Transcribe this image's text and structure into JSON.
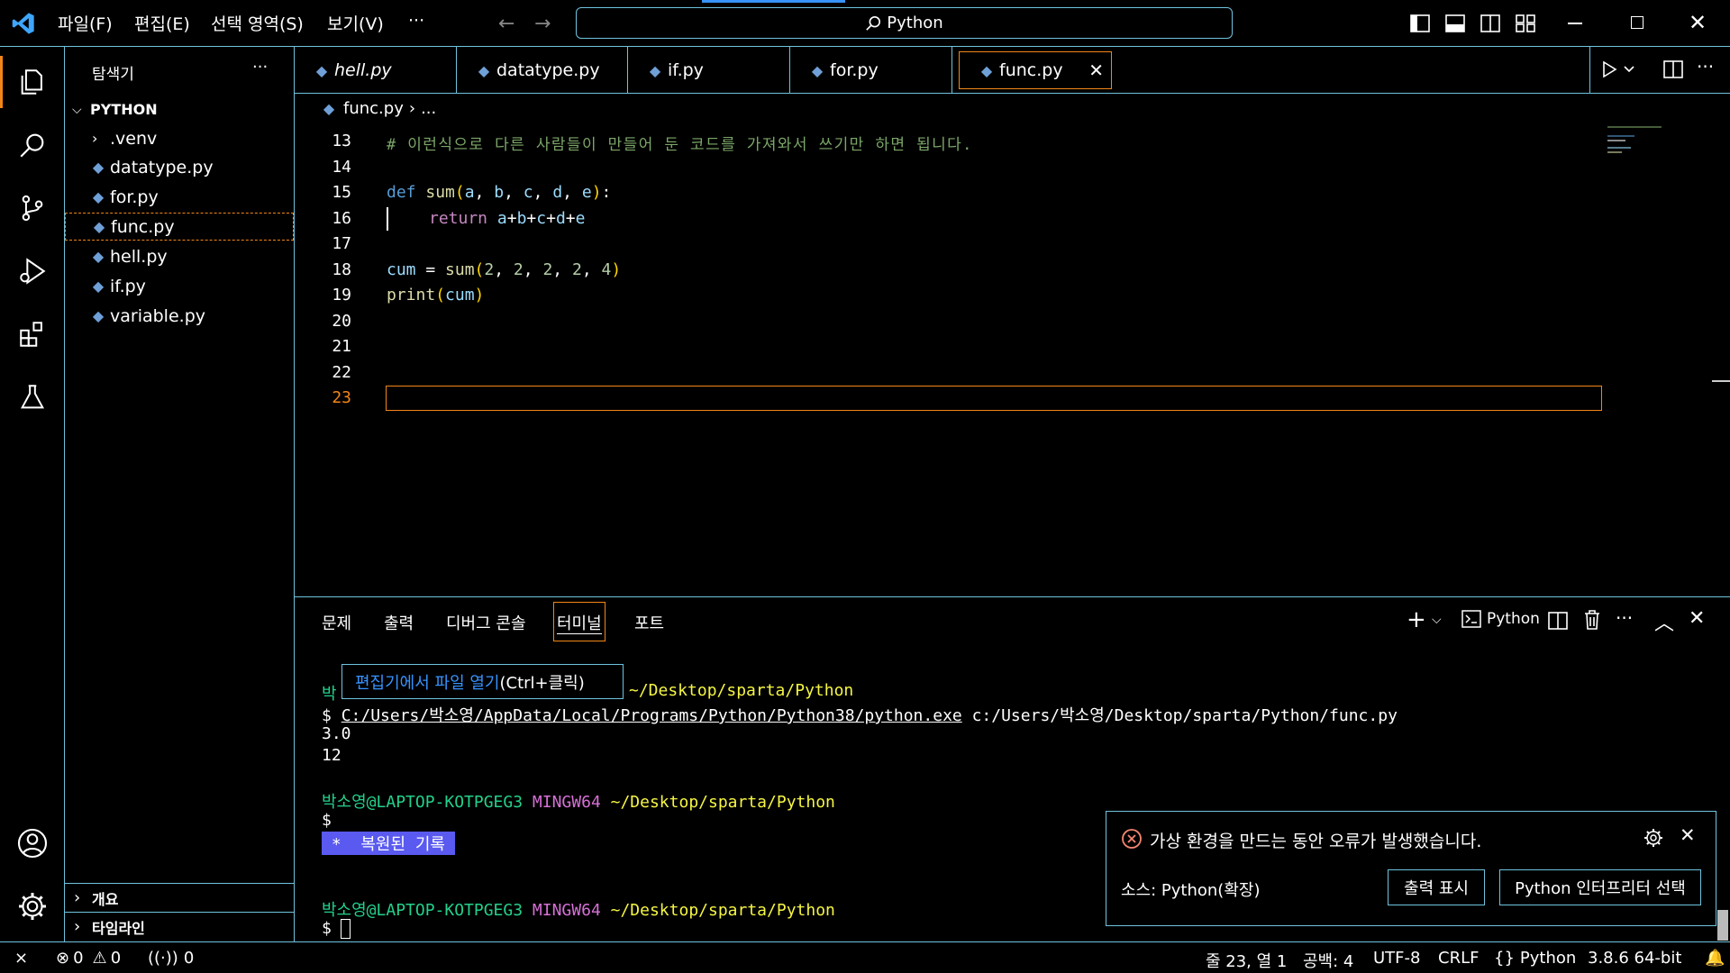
{
  "titlebar": {
    "menus": [
      "파일(F)",
      "편집(E)",
      "선택 영역(S)",
      "보기(V)",
      "···"
    ],
    "search_text": "Python"
  },
  "sidebar": {
    "title": "탐색기",
    "more": "···",
    "root": "PYTHON",
    "items": [
      ".venv",
      "datatype.py",
      "for.py",
      "func.py",
      "hell.py",
      "if.py",
      "variable.py"
    ],
    "outline": "개요",
    "timeline": "타임라인"
  },
  "tabs": [
    {
      "label": "hell.py"
    },
    {
      "label": "datatype.py"
    },
    {
      "label": "if.py"
    },
    {
      "label": "for.py"
    },
    {
      "label": "func.py",
      "active": true
    }
  ],
  "breadcrumb": {
    "file": "func.py",
    "rest": "..."
  },
  "editor": {
    "line_numbers": [
      "13",
      "14",
      "15",
      "16",
      "17",
      "18",
      "19",
      "20",
      "21",
      "22",
      "23"
    ],
    "comment": "# 이런식으로 다른 사람들이 만들어 둔 코드를 가져와서 쓰기만 하면 됩니다."
  },
  "panel": {
    "tabs": [
      "문제",
      "출력",
      "디버그 콘솔",
      "터미널",
      "포트"
    ],
    "active_tab": "터미널",
    "shell_label": "Python",
    "tooltip_link": "편집기에서 파일 열기",
    "tooltip_hint": " (Ctrl+클릭)",
    "terminal": {
      "user_host": "박소영@LAPTOP-KOTPGEG3",
      "user_partial": "박",
      "mingw": "MINGW64",
      "path": "~/Desktop/sparta/Python",
      "prompt": "$",
      "cmd_exe": "C:/Users/박소영/AppData/Local/Programs/Python/Python38/python.exe",
      "cmd_arg": " c:/Users/박소영/Desktop/sparta/Python/func.py",
      "out1": "3.0",
      "out2": "12",
      "restored": " *  복원된 기록 "
    }
  },
  "notification": {
    "message": "가상 환경을 만드는 동안 오류가 발생했습니다.",
    "source": "소스: Python(확장)",
    "btn_output": "출력 표시",
    "btn_interpreter": "Python 인터프리터 선택"
  },
  "statusbar": {
    "errors": "0",
    "warnings": "0",
    "ports": "0",
    "position": "줄 23, 열 1",
    "spaces": "공백: 4",
    "encoding": "UTF-8",
    "eol": "CRLF",
    "language": "Python",
    "interpreter": "3.8.6 64-bit"
  },
  "colors": {
    "accent_border": "#6fc3df",
    "active_border": "#f38518",
    "keyword": "#569cd6",
    "function": "#dcdcaa",
    "variable": "#9cdcfe",
    "terminal_green": "#23d18b"
  }
}
